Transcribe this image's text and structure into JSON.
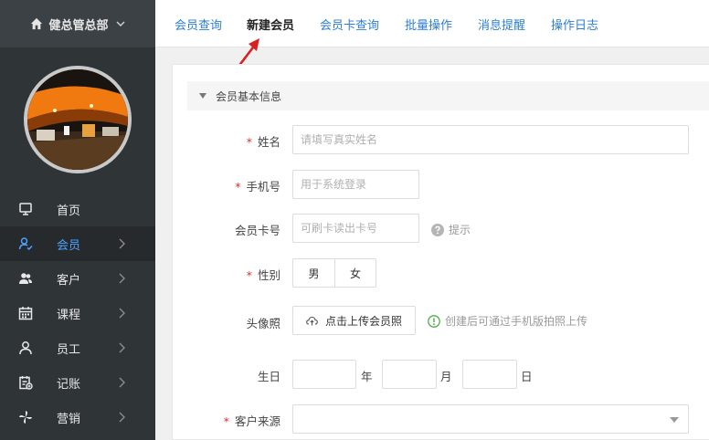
{
  "brand": {
    "title": "健总管总部"
  },
  "sidebar": {
    "items": [
      {
        "label": "首页",
        "icon": "monitor-icon"
      },
      {
        "label": "会员",
        "icon": "member-icon",
        "active": true
      },
      {
        "label": "客户",
        "icon": "customers-icon"
      },
      {
        "label": "课程",
        "icon": "calendar-icon"
      },
      {
        "label": "员工",
        "icon": "staff-icon"
      },
      {
        "label": "记账",
        "icon": "ledger-icon"
      },
      {
        "label": "营销",
        "icon": "pinwheel-icon"
      }
    ]
  },
  "tabs": [
    {
      "label": "会员查询"
    },
    {
      "label": "新建会员",
      "active": true
    },
    {
      "label": "会员卡查询"
    },
    {
      "label": "批量操作"
    },
    {
      "label": "消息提醒"
    },
    {
      "label": "操作日志"
    }
  ],
  "form": {
    "section_title": "会员基本信息",
    "required_mark": "*",
    "name": {
      "label": "姓名",
      "placeholder": "请填写真实姓名"
    },
    "phone": {
      "label": "手机号",
      "placeholder": "用于系统登录"
    },
    "card": {
      "label": "会员卡号",
      "placeholder": "可刷卡读出卡号",
      "hint": "提示"
    },
    "gender": {
      "label": "性别",
      "options": [
        "男",
        "女"
      ]
    },
    "photo": {
      "label": "头像照",
      "button": "点击上传会员照",
      "hint": "创建后可通过手机版拍照上传"
    },
    "birthday": {
      "label": "生日",
      "year": "年",
      "month": "月",
      "day": "日"
    },
    "source": {
      "label": "客户来源"
    }
  },
  "colors": {
    "accent": "#2b7fd4",
    "sidebar": "#2f3437",
    "required": "#d9342b",
    "annotation": "#d91f1f"
  }
}
